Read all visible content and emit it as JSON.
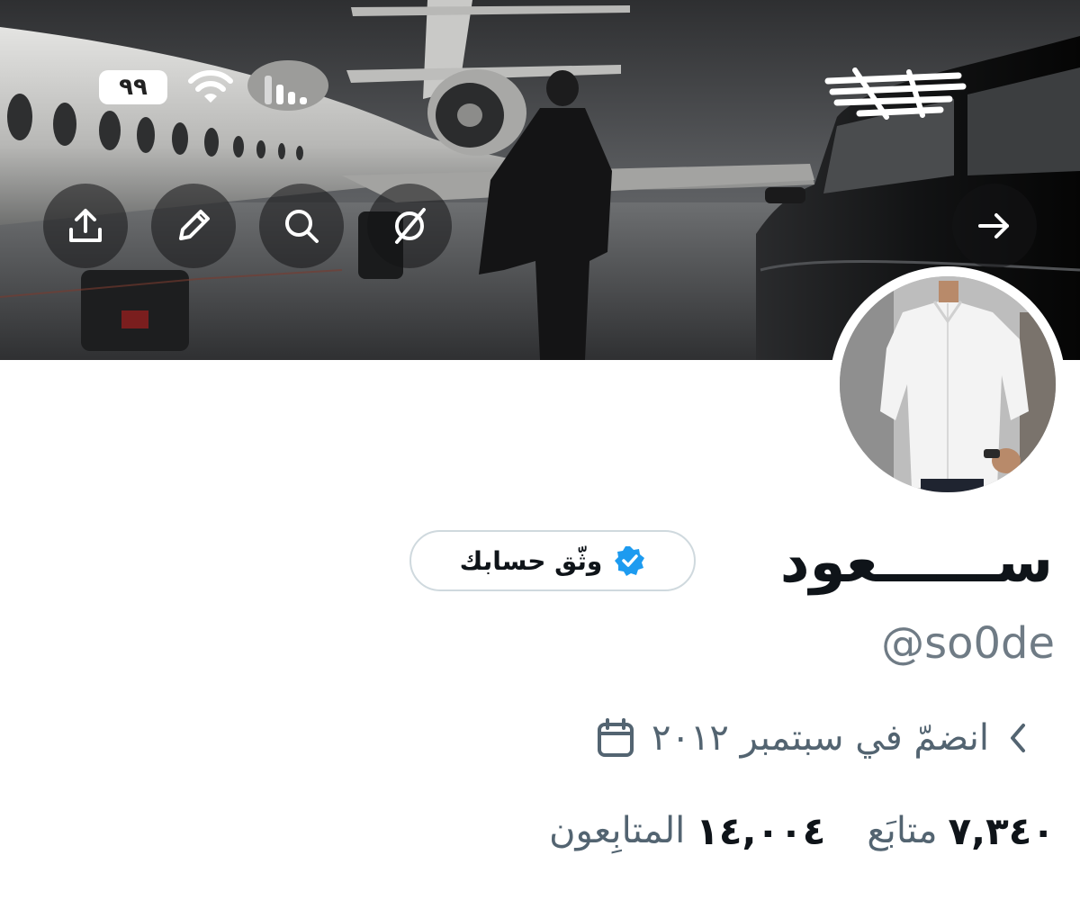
{
  "status_bar": {
    "battery_label": "٩٩",
    "wifi_icon": "wifi-icon",
    "signal_icon": "signal-bars-icon"
  },
  "banner_actions": [
    {
      "name": "share",
      "icon": "upload-icon"
    },
    {
      "name": "edit",
      "icon": "pencil-icon"
    },
    {
      "name": "search",
      "icon": "search-icon"
    },
    {
      "name": "hide",
      "icon": "eye-slash-icon"
    }
  ],
  "forward_button": {
    "icon": "arrow-right-icon"
  },
  "profile": {
    "display_name": "ســــــعود",
    "verify_label": "وثّق حسابك",
    "handle": "@so0de",
    "joined": "انضمّ في سبتمبر ٢٠١٢",
    "following_count": "٧,٣٤٠",
    "following_label": "متابَع",
    "followers_count": "١٤,٠٠٤",
    "followers_label": "المتابِعون"
  },
  "colors": {
    "verified_badge": "#1d9bf0",
    "text_primary": "#0f1419",
    "text_secondary": "#536471",
    "pill_border": "#cfd9de"
  }
}
